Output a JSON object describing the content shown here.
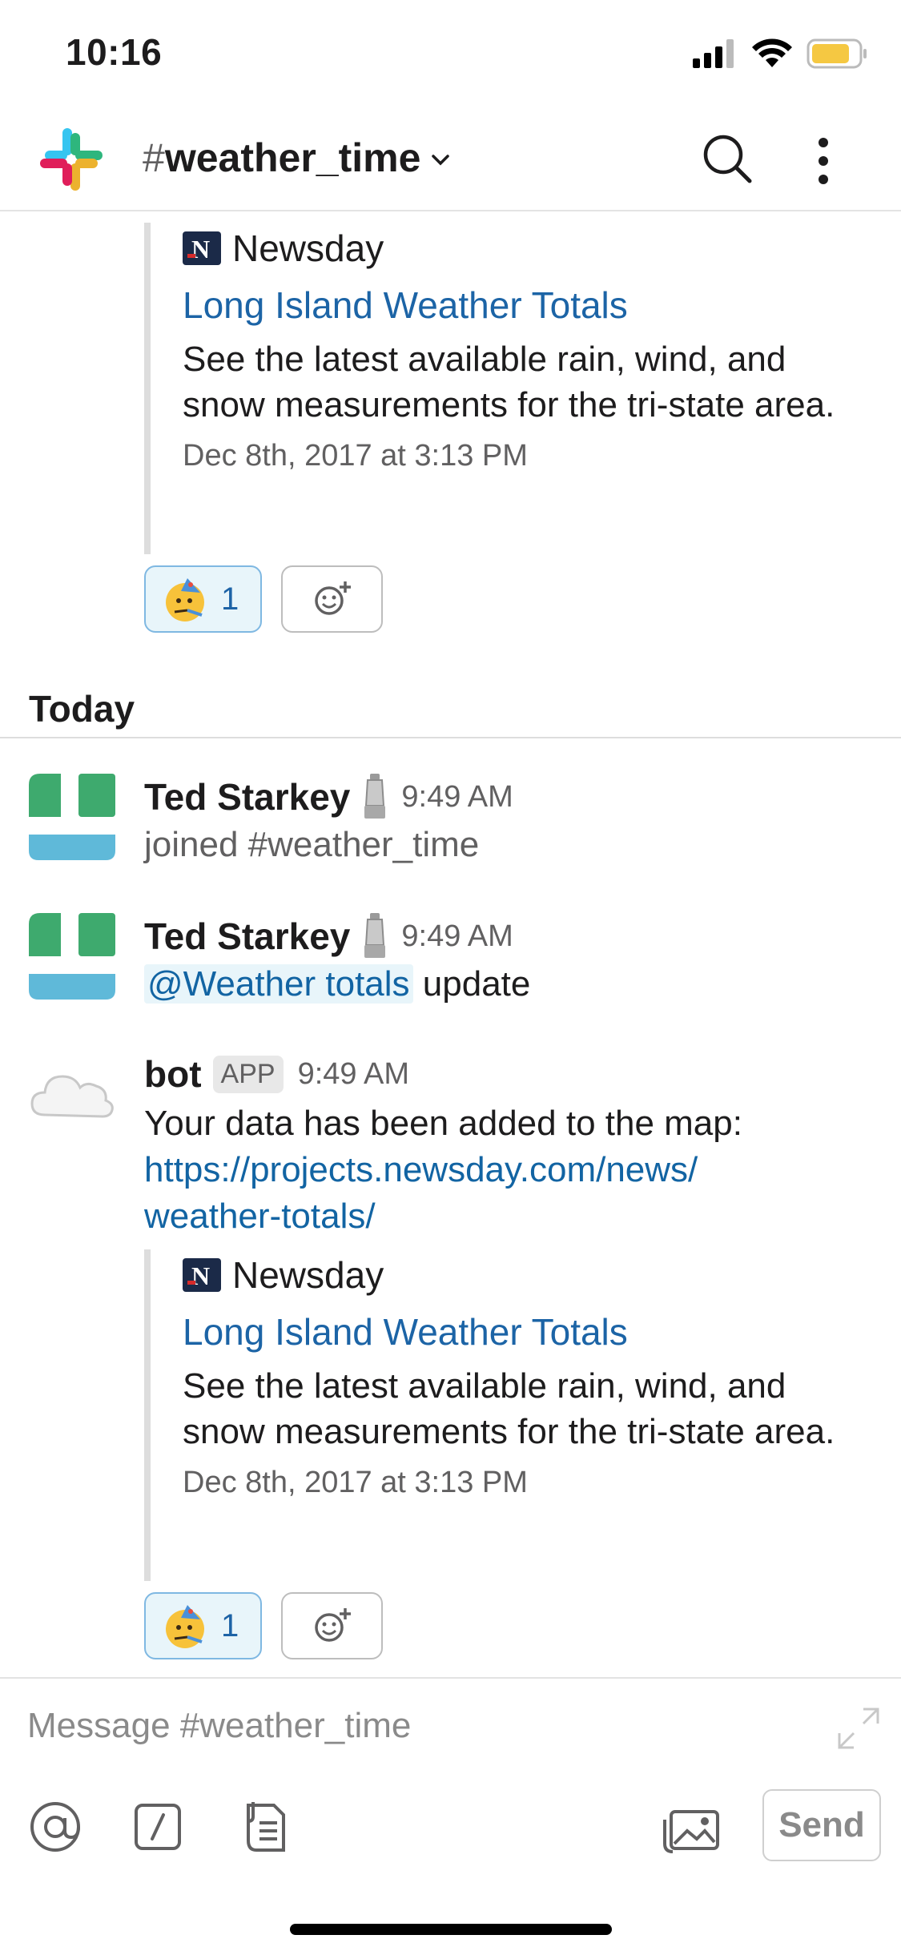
{
  "status_bar": {
    "time": "10:16"
  },
  "header": {
    "channel_hash": "#",
    "channel_name": "weather_time"
  },
  "attachments": [
    {
      "source": "Newsday",
      "title": "Long Island Weather Totals",
      "description": "See the latest available rain, wind, and snow measurements for the tri-state area.",
      "date": "Dec 8th, 2017 at 3:13 PM",
      "reaction_count": "1"
    },
    {
      "source": "Newsday",
      "title": "Long Island Weather Totals",
      "description": "See the latest available rain, wind, and snow measurements for the tri-state area.",
      "date": "Dec 8th, 2017 at 3:13 PM",
      "reaction_count": "1"
    }
  ],
  "day_divider": "Today",
  "messages": [
    {
      "author": "Ted Starkey",
      "time": "9:49 AM",
      "text": "joined #weather_time"
    },
    {
      "author": "Ted Starkey",
      "time": "9:49 AM",
      "mention": "@Weather totals",
      "text": " update"
    },
    {
      "author": "bot",
      "badge": "APP",
      "time": "9:49 AM",
      "text": "Your data has been added to the map:",
      "link_line1": "https://projects.newsday.com/news/",
      "link_line2": "weather-totals/"
    }
  ],
  "composer": {
    "placeholder": "Message #weather_time",
    "send_label": "Send"
  },
  "icons": {
    "status": [
      "cellular-signal-icon",
      "wifi-icon",
      "battery-icon"
    ],
    "header": [
      "slack-logo",
      "chevron-down-icon",
      "search-icon",
      "more-vertical-icon"
    ],
    "composer": [
      "at-mention-icon",
      "slash-command-icon",
      "file-attach-icon",
      "photo-library-icon",
      "expand-icon"
    ],
    "reaction_emoji": "partying-face-emoji",
    "add_reaction": "add-reaction-icon",
    "author_status": "trophy-icon",
    "bot_avatar": "cloud-emoji"
  },
  "colors": {
    "link": "#1264a3",
    "battery": "#f5c842",
    "avatar_green": "#3eaa6e",
    "avatar_blue": "#5fb9d9"
  }
}
